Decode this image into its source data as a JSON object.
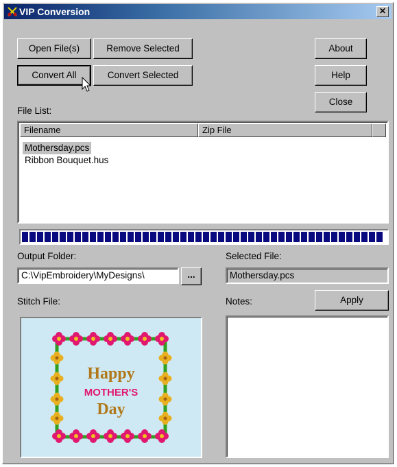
{
  "window": {
    "title": "VIP Conversion",
    "close_glyph": "✕"
  },
  "buttons": {
    "open_files": "Open File(s)",
    "remove_selected": "Remove Selected",
    "convert_all": "Convert All",
    "convert_selected": "Convert Selected",
    "about": "About",
    "help": "Help",
    "close": "Close",
    "browse": "...",
    "apply": "Apply"
  },
  "file_list": {
    "label": "File List:",
    "columns": [
      "Filename",
      "Zip File"
    ],
    "rows": [
      {
        "filename": "Mothersday.pcs",
        "zip": "",
        "selected": true
      },
      {
        "filename": "Ribbon Bouquet.hus",
        "zip": "",
        "selected": false
      }
    ]
  },
  "progress": {
    "fraction": 1.0,
    "color": "#0a0a80"
  },
  "output": {
    "label": "Output Folder:",
    "value": "C:\\VipEmbroidery\\MyDesigns\\"
  },
  "selected_file": {
    "label": "Selected File:",
    "value": "Mothersday.pcs"
  },
  "stitch": {
    "label": "Stitch File:",
    "preview_words": [
      "Happy",
      "MOTHER'S",
      "Day"
    ]
  },
  "notes": {
    "label": "Notes:",
    "value": ""
  },
  "colors": {
    "title_start": "#0a246a",
    "title_end": "#a6caf0",
    "face": "#c0c0c0"
  }
}
